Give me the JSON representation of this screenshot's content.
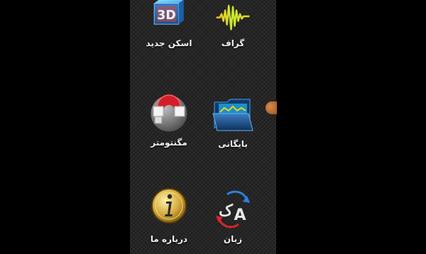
{
  "menu": {
    "items": [
      {
        "id": "scan3d",
        "label": "اسکن جدید",
        "icon": "3d-cube-icon"
      },
      {
        "id": "graph",
        "label": "گراف",
        "icon": "waveform-icon"
      },
      {
        "id": "magnetometer",
        "label": "مگنتومتر",
        "icon": "magnet-icon"
      },
      {
        "id": "archive",
        "label": "بایگانی",
        "icon": "folder-icon"
      },
      {
        "id": "about",
        "label": "درباره ما",
        "icon": "info-icon"
      },
      {
        "id": "language",
        "label": "زبان",
        "icon": "language-icon"
      }
    ]
  },
  "icons": {
    "scan3d_text": "3D"
  },
  "colors": {
    "background": "#262626",
    "label": "#f2f2f2",
    "handle": "#c7773a"
  }
}
